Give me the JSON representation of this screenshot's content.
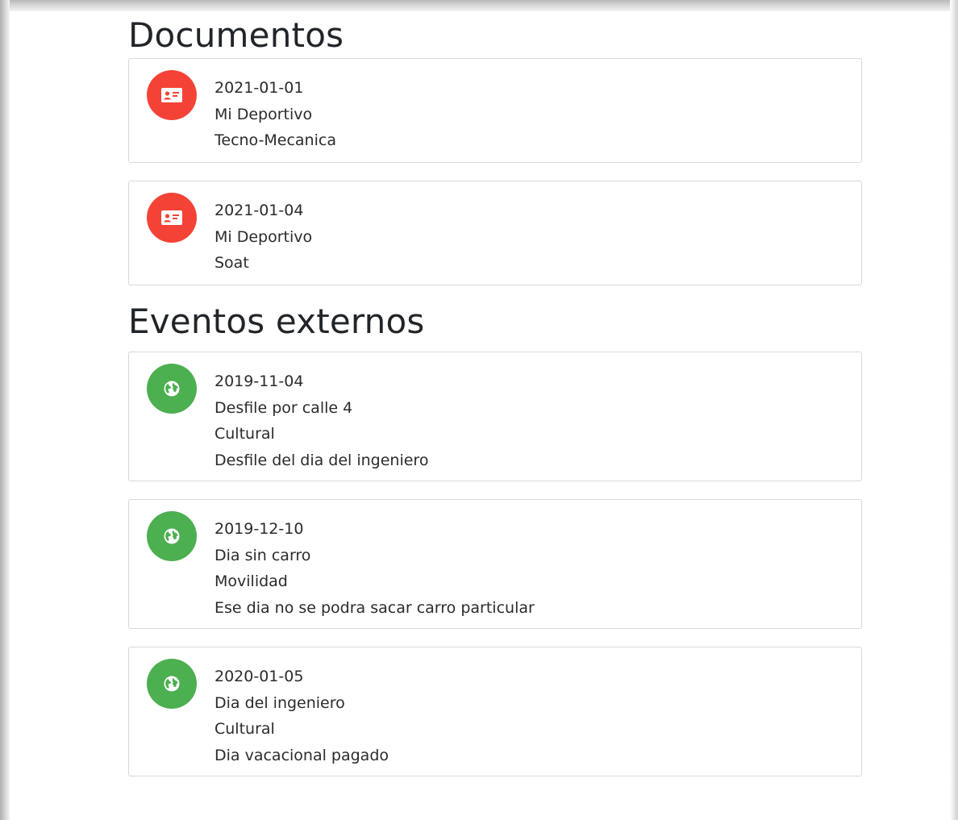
{
  "colors": {
    "document_avatar": "#f44336",
    "event_avatar": "#4caf50",
    "card_border": "#d9d9d9"
  },
  "documents_section": {
    "title": "Documentos",
    "icon": "id-card-icon",
    "items": [
      {
        "date": "2021-01-01",
        "vehicle": "Mi Deportivo",
        "type": "Tecno-Mecanica"
      },
      {
        "date": "2021-01-04",
        "vehicle": "Mi Deportivo",
        "type": "Soat"
      }
    ]
  },
  "events_section": {
    "title": "Eventos externos",
    "icon": "globe-icon",
    "items": [
      {
        "date": "2019-11-04",
        "name": "Desfile por calle 4",
        "category": "Cultural",
        "description": "Desfile del dia del ingeniero"
      },
      {
        "date": "2019-12-10",
        "name": "Dia sin carro",
        "category": "Movilidad",
        "description": "Ese dia no se podra sacar carro particular"
      },
      {
        "date": "2020-01-05",
        "name": "Dia del ingeniero",
        "category": "Cultural",
        "description": "Dia vacacional pagado"
      }
    ]
  }
}
